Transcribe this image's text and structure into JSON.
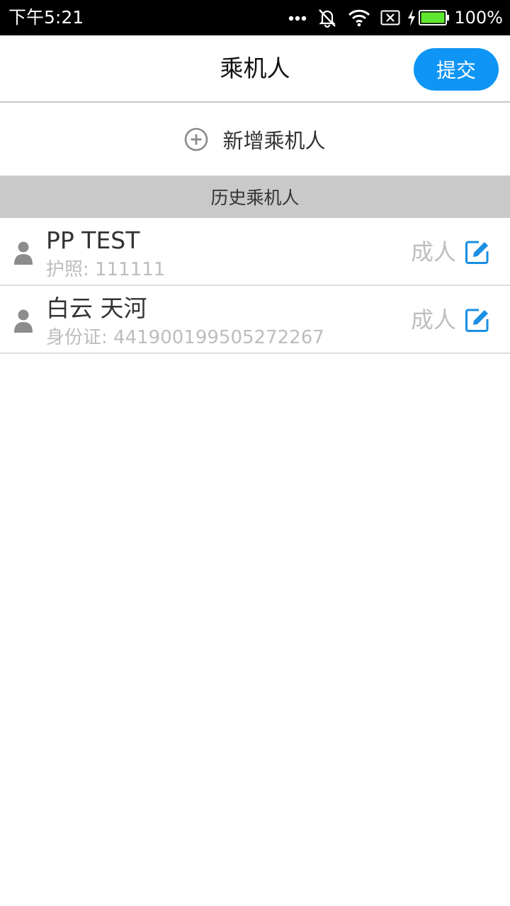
{
  "status_bar": {
    "time": "下午5:21",
    "battery_text": "100%",
    "icons": [
      "more-dots-icon",
      "mute-icon",
      "wifi-icon",
      "no-sim-icon",
      "charging-bolt-icon",
      "battery-icon"
    ]
  },
  "header": {
    "title": "乘机人",
    "submit_label": "提交"
  },
  "add_passenger": {
    "label": "新增乘机人",
    "icon": "add-circle-icon"
  },
  "history_section": {
    "title": "历史乘机人"
  },
  "passengers": [
    {
      "name": "PP TEST",
      "document": "护照: 111111",
      "type": "成人"
    },
    {
      "name": "白云 天河",
      "document": "身份证: 441900199505272267",
      "type": "成人"
    }
  ],
  "colors": {
    "accent": "#0e95f5",
    "section_bg": "#c9c9c9",
    "muted_text": "#bdbdbd",
    "edit_icon": "#1a8fe3"
  }
}
